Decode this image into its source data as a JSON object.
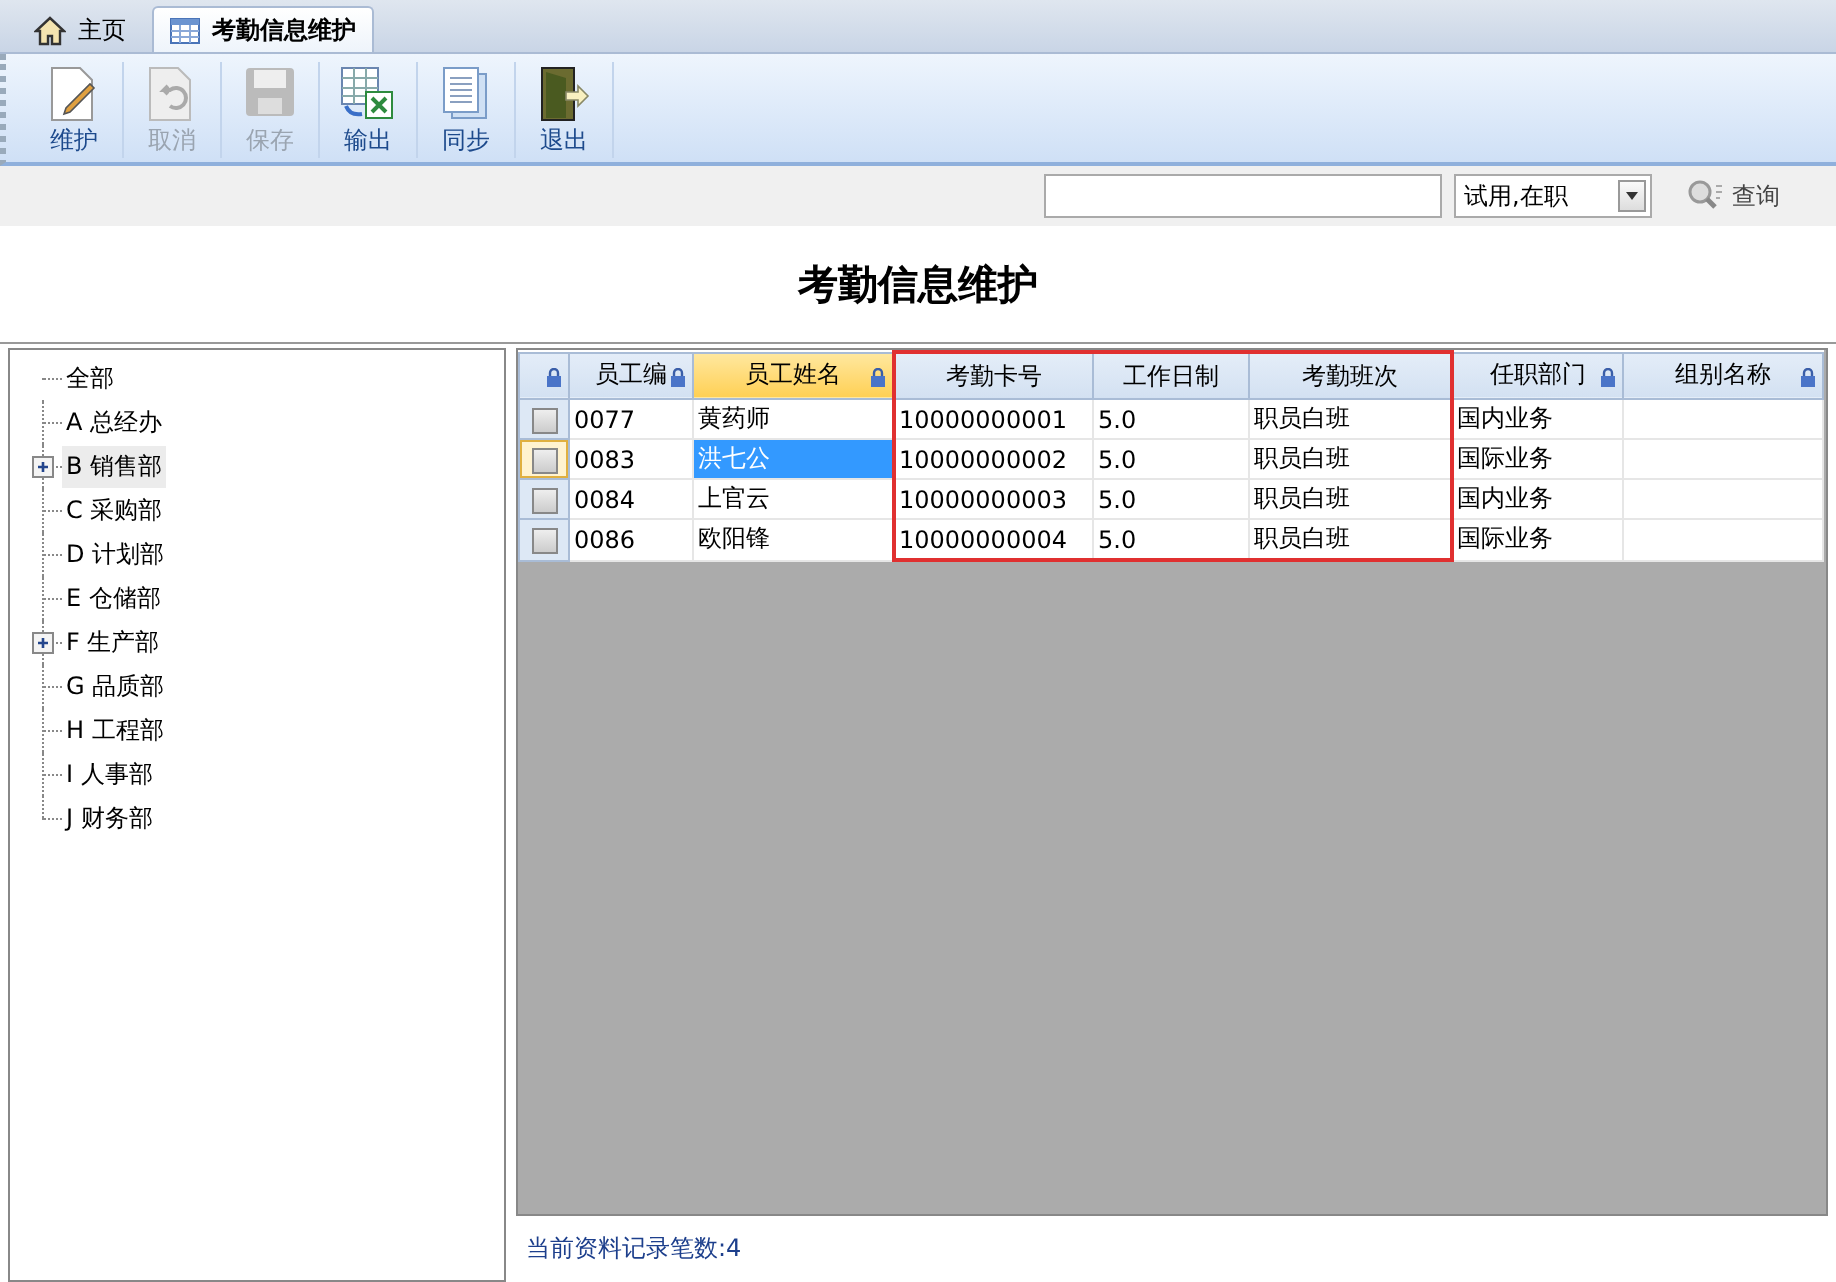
{
  "tabs": [
    {
      "label": "主页",
      "kind": "home",
      "selected": false
    },
    {
      "label": "考勤信息维护",
      "kind": "table",
      "selected": true
    }
  ],
  "toolbar": [
    {
      "label": "维护",
      "kind": "edit",
      "disabled": false
    },
    {
      "label": "取消",
      "kind": "undo",
      "disabled": true
    },
    {
      "label": "保存",
      "kind": "save",
      "disabled": true
    },
    {
      "label": "输出",
      "kind": "export",
      "disabled": false
    },
    {
      "label": "同步",
      "kind": "sync",
      "disabled": false
    },
    {
      "label": "退出",
      "kind": "exit",
      "disabled": false
    }
  ],
  "filter": {
    "status_value": "试用,在职",
    "query_button": "查询"
  },
  "page_title": "考勤信息维护",
  "tree": {
    "label": "全部",
    "selected": false,
    "children": [
      {
        "label": "A 总经办",
        "selected": false,
        "expandable": false
      },
      {
        "label": "B 销售部",
        "selected": true,
        "expandable": true
      },
      {
        "label": "C 采购部",
        "selected": false,
        "expandable": false
      },
      {
        "label": "D 计划部",
        "selected": false,
        "expandable": false
      },
      {
        "label": "E 仓储部",
        "selected": false,
        "expandable": false
      },
      {
        "label": "F 生产部",
        "selected": false,
        "expandable": true
      },
      {
        "label": "G 品质部",
        "selected": false,
        "expandable": false
      },
      {
        "label": "H 工程部",
        "selected": false,
        "expandable": false
      },
      {
        "label": "I 人事部",
        "selected": false,
        "expandable": false
      },
      {
        "label": "J 财务部",
        "selected": false,
        "expandable": false
      }
    ]
  },
  "table": {
    "columns": [
      {
        "label": "员工编",
        "locked": true,
        "selected": false,
        "outlined": false
      },
      {
        "label": "员工姓名",
        "locked": true,
        "selected": true,
        "outlined": false
      },
      {
        "label": "考勤卡号",
        "locked": false,
        "selected": false,
        "outlined": true
      },
      {
        "label": "工作日制",
        "locked": false,
        "selected": false,
        "outlined": true
      },
      {
        "label": "考勤班次",
        "locked": false,
        "selected": false,
        "outlined": true
      },
      {
        "label": "任职部门",
        "locked": true,
        "selected": false,
        "outlined": false
      },
      {
        "label": "组别名称",
        "locked": true,
        "selected": false,
        "outlined": false
      }
    ],
    "select_column_locked": true,
    "rows": [
      {
        "selected": false,
        "checked": false,
        "cells": [
          "0077",
          "黄药师",
          "10000000001",
          "5.0",
          "职员白班",
          "国内业务",
          ""
        ]
      },
      {
        "selected": true,
        "checked": false,
        "cells": [
          "0083",
          "洪七公",
          "10000000002",
          "5.0",
          "职员白班",
          "国际业务",
          ""
        ]
      },
      {
        "selected": false,
        "checked": false,
        "cells": [
          "0084",
          "上官云",
          "10000000003",
          "5.0",
          "职员白班",
          "国内业务",
          ""
        ]
      },
      {
        "selected": false,
        "checked": false,
        "cells": [
          "0086",
          "欧阳锋",
          "10000000004",
          "5.0",
          "职员白班",
          "国际业务",
          ""
        ]
      }
    ]
  },
  "status_text": "当前资料记录笔数:4"
}
